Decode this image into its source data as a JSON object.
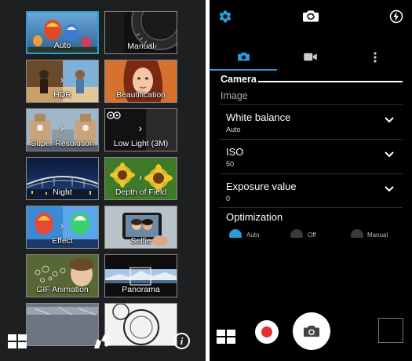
{
  "left": {
    "modes": [
      {
        "label": "Auto",
        "selected": true,
        "arrow": false
      },
      {
        "label": "Manual",
        "selected": false,
        "arrow": false
      },
      {
        "label": "HDR",
        "selected": false,
        "arrow": true
      },
      {
        "label": "Beautification",
        "selected": false,
        "arrow": false
      },
      {
        "label": "Super Resolution",
        "selected": false,
        "arrow": true
      },
      {
        "label": "Low Light (3M)",
        "selected": false,
        "arrow": true
      },
      {
        "label": "Night",
        "selected": false,
        "arrow": false
      },
      {
        "label": "Depth of Field",
        "selected": false,
        "arrow": true
      },
      {
        "label": "Effect",
        "selected": false,
        "arrow": true
      },
      {
        "label": "Selfie",
        "selected": false,
        "arrow": false
      },
      {
        "label": "GIF Animation",
        "selected": false,
        "arrow": false
      },
      {
        "label": "Panorama",
        "selected": false,
        "arrow": false
      },
      {
        "label": "",
        "selected": false,
        "arrow": false
      },
      {
        "label": "",
        "selected": false,
        "arrow": false
      }
    ],
    "bar_icons": [
      "grid-icon",
      "camera-mode-icon",
      "info-icon"
    ],
    "info_glyph": "i"
  },
  "right": {
    "top_icons": [
      "gear-icon",
      "switch-camera-icon",
      "flash-auto-icon"
    ],
    "tabs": [
      {
        "icon": "camera-icon",
        "active": true
      },
      {
        "icon": "video-icon",
        "active": false
      },
      {
        "icon": "more-icon",
        "active": false
      }
    ],
    "section_title": "Camera",
    "subhead": "Image",
    "settings": [
      {
        "title": "White balance",
        "value": "Auto"
      },
      {
        "title": "ISO",
        "value": "50"
      },
      {
        "title": "Exposure value",
        "value": "0"
      }
    ],
    "optimization": {
      "title": "Optimization",
      "options": [
        {
          "label": "Auto",
          "on": true
        },
        {
          "label": "Off",
          "on": false
        },
        {
          "label": "Manual",
          "on": false
        }
      ]
    }
  },
  "colors": {
    "accent": "#2b9bd8",
    "record": "#e5302f",
    "panel": "#1e1f21"
  }
}
